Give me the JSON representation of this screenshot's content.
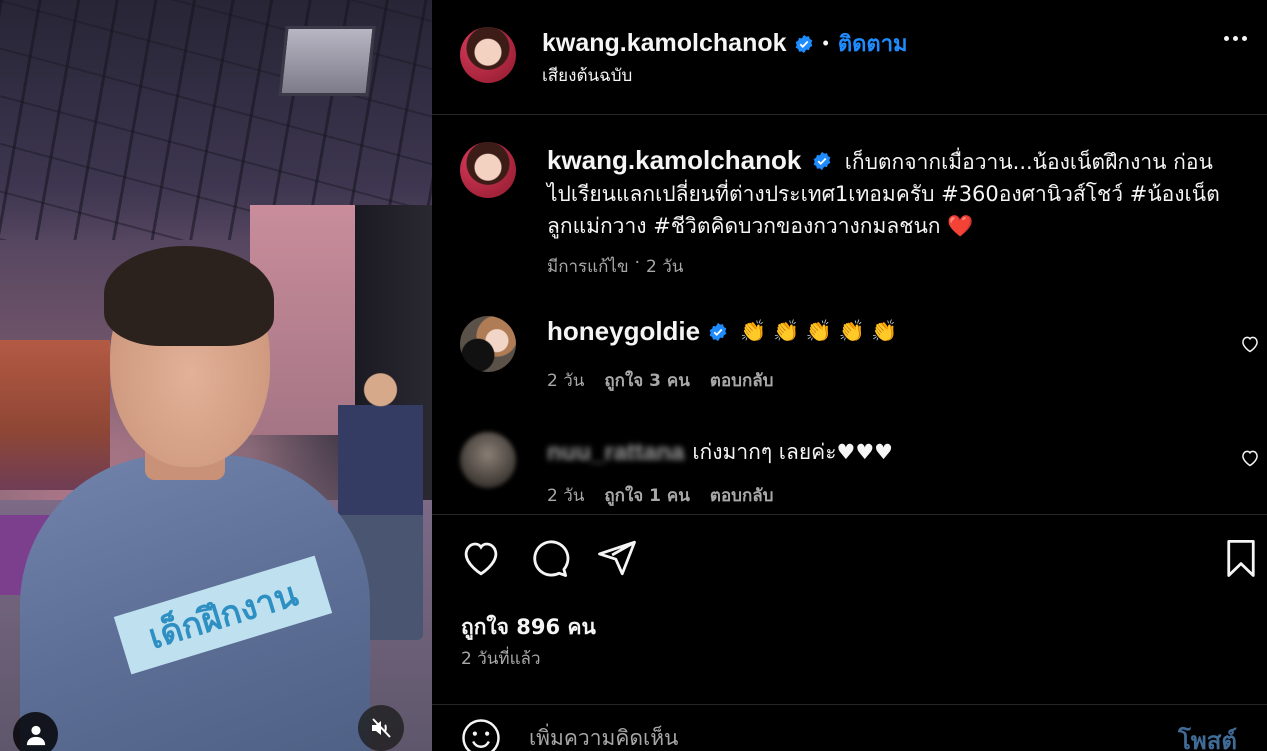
{
  "post": {
    "username": "kwang.kamolchanok",
    "follow_label": "ติดตาม",
    "audio_label": "เสียงต้นฉบับ",
    "more_icon": "more-horizontal-icon",
    "verified_color": "#1e8cff"
  },
  "media": {
    "sticker_text": "เด็กฝึกงาน",
    "user_tag_icon": "user-icon",
    "mute_icon": "speaker-muted-icon"
  },
  "caption": {
    "username": "kwang.kamolchanok",
    "text": "เก็บตกจากเมื่อวาน...น้องเน็ตฝึกงาน ก่อนไปเรียนแลกเปลี่ยนที่ต่างประเทศ1เทอมครับ #360องศานิวส์โชว์ #น้องเน็ตลูกแม่กวาง #ชีวิตคิดบวกของกวางกมลชนก ❤️",
    "edited": "มีการแก้ไข",
    "age": "2 วัน"
  },
  "comments": [
    {
      "username": "honeygoldie",
      "verified": true,
      "text": "👏 👏 👏 👏 👏",
      "age": "2 วัน",
      "likes": "ถูกใจ 3 คน",
      "reply": "ตอบกลับ"
    },
    {
      "username": "nuu_rattana",
      "verified": false,
      "text": "เก่งมากๆ เลยค่ะ♥♥♥",
      "age": "2 วัน",
      "likes": "ถูกใจ 1 คน",
      "reply": "ตอบกลับ"
    }
  ],
  "actions": {
    "likes": "ถูกใจ 896 คน",
    "posted": "2 วันที่แล้ว"
  },
  "composer": {
    "placeholder": "เพิ่มความคิดเห็น",
    "post_label": "โพสต์"
  },
  "colors": {
    "background": "#000000",
    "link_blue": "#1e8cff",
    "muted_text": "#a8a8a8",
    "post_button_disabled": "#3f6b96"
  }
}
